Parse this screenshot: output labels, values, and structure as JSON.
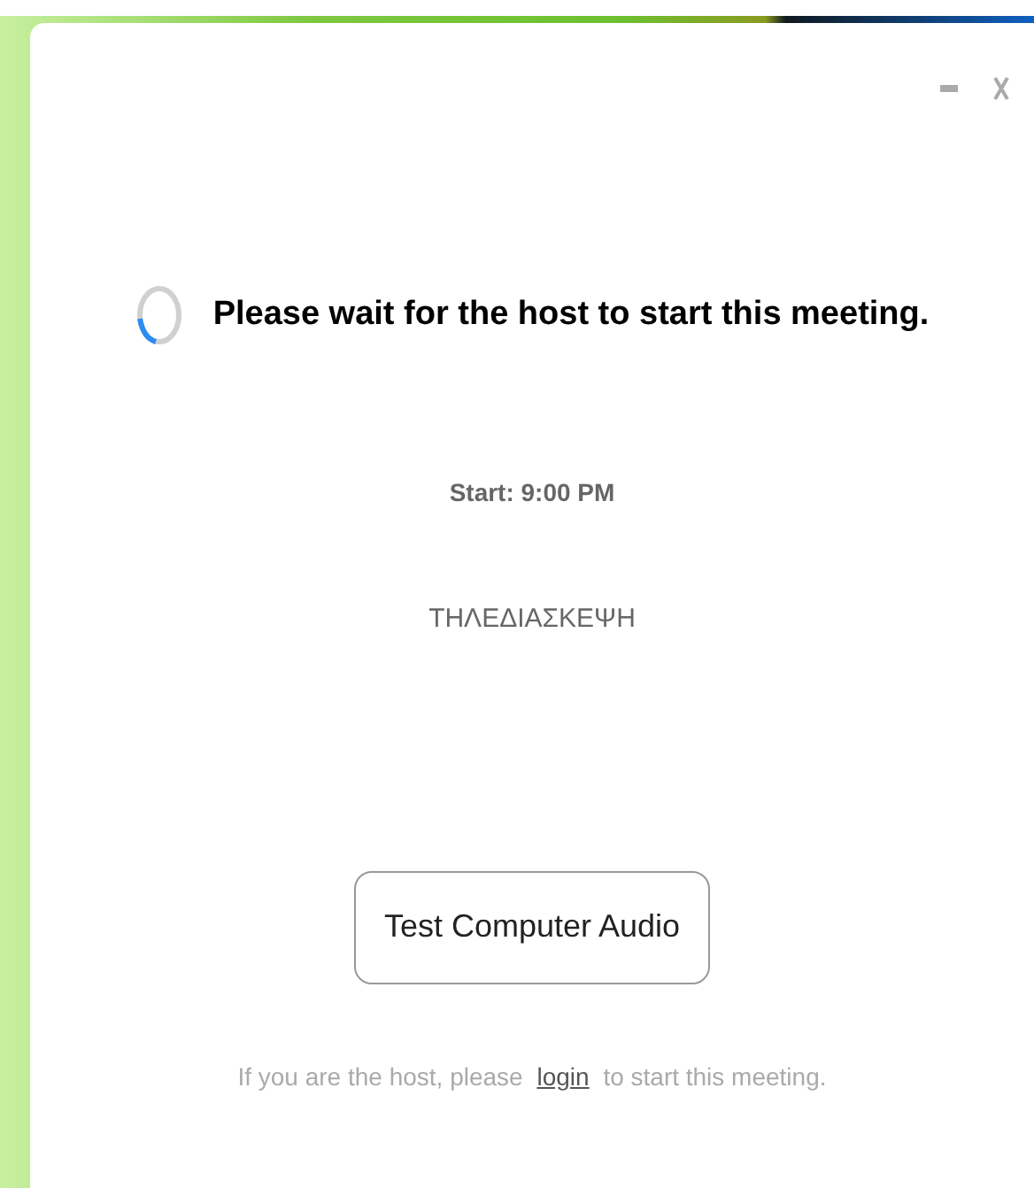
{
  "window": {
    "controls": [
      {
        "kind": "minimize"
      },
      {
        "kind": "close"
      }
    ]
  },
  "status": {
    "message": "Please wait for the host to start this meeting.",
    "start_time": "Start: 9:00 PM",
    "meeting_topic": "ΤΗΛΕΔΙΑΣΚΕΨΗ"
  },
  "buttons": [
    {
      "label": "Test Computer Audio"
    }
  ],
  "footer": {
    "before": "If you are the host, please",
    "link": "login",
    "after": "to start this meeting."
  }
}
